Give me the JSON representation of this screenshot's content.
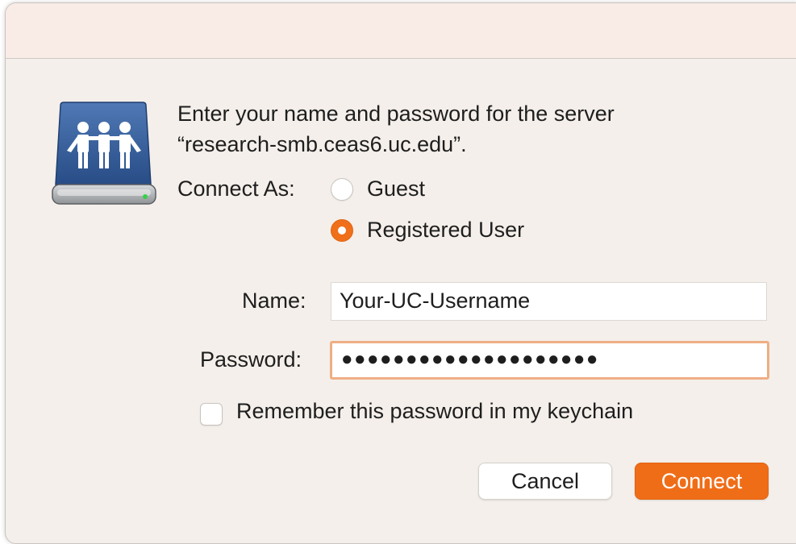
{
  "prompt": {
    "line1": "Enter your name and password for the server",
    "line2": "“research-smb.ceas6.uc.edu”."
  },
  "connect_as": {
    "label": "Connect As:",
    "options": [
      {
        "label": "Guest",
        "selected": false
      },
      {
        "label": "Registered User",
        "selected": true
      }
    ]
  },
  "name_field": {
    "label": "Name:",
    "value": "Your-UC-Username"
  },
  "password_field": {
    "label": "Password:",
    "value": "●●●●●●●●●●●●●●●●●●●●"
  },
  "remember": {
    "label": "Remember this password in my keychain",
    "checked": false
  },
  "buttons": {
    "cancel": "Cancel",
    "connect": "Connect"
  },
  "colors": {
    "accent": "#f06d18",
    "window_bg": "#f4efea",
    "titlebar_bg": "#f9ebe6"
  },
  "icons": {
    "server": "shared-server-drive-icon"
  }
}
